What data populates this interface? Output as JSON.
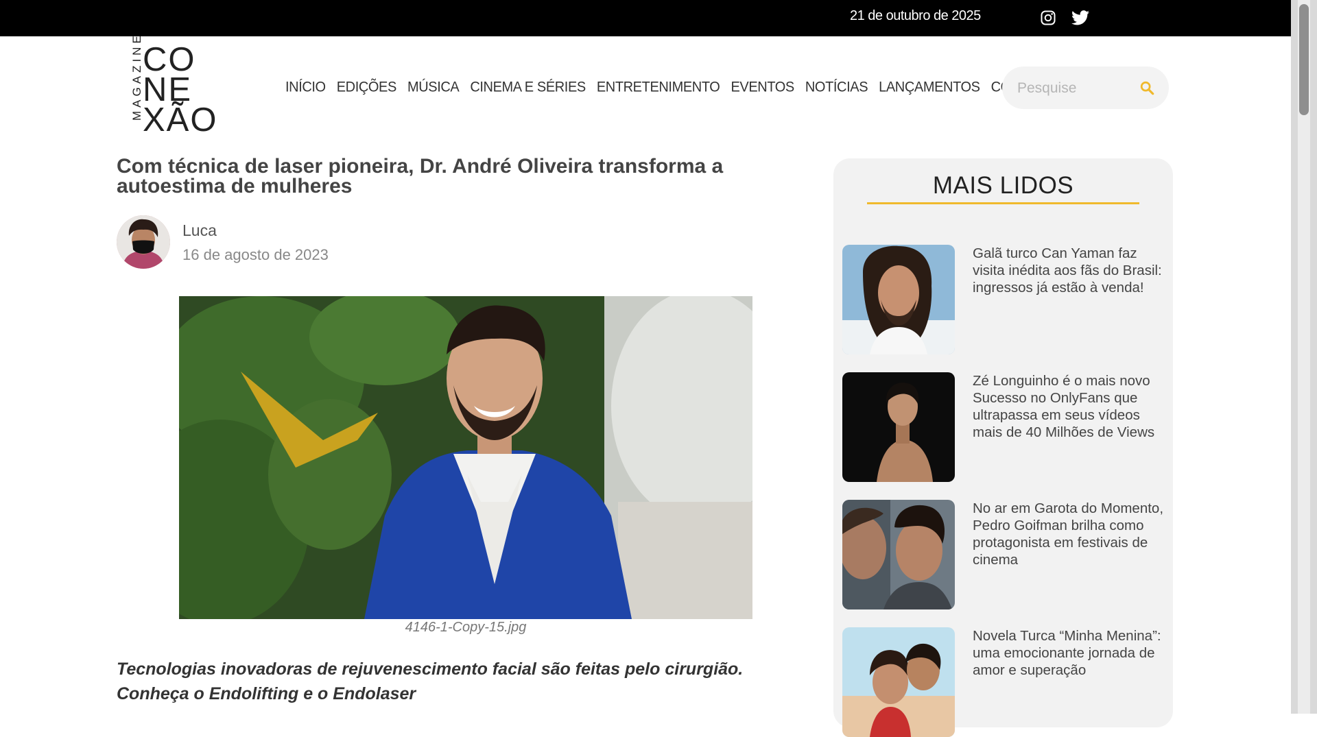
{
  "topbar": {
    "date": "21 de outubro de 2025"
  },
  "logo": {
    "magazine": "MAGAZINE",
    "line1": "CO",
    "line2": "NE",
    "line3": "XÃO"
  },
  "nav": [
    "INÍCIO",
    "EDIÇÕES",
    "MÚSICA",
    "CINEMA E SÉRIES",
    "ENTRETENIMENTO",
    "EVENTOS",
    "NOTÍCIAS",
    "LANÇAMENTOS",
    "CONTATO"
  ],
  "search": {
    "placeholder": "Pesquise"
  },
  "article": {
    "title": "Com técnica de laser pioneira, Dr. André Oliveira transforma a autoestima de mulheres",
    "author": "Luca",
    "date": "16 de agosto de 2023",
    "image_caption": "4146-1-Copy-15.jpg",
    "lead": "Tecnologias inovadoras de rejuvenescimento facial são feitas pelo cirurgião. Conheça o Endolifting e o Endolaser"
  },
  "sidebar": {
    "title": "MAIS LIDOS",
    "items": [
      {
        "text": "Galã turco Can Yaman faz visita inédita aos fãs do Brasil: ingressos já estão à venda!"
      },
      {
        "text": "Zé Longuinho é o mais novo Sucesso no OnlyFans que ultrapassa em seus vídeos mais de 40 Milhões de Views"
      },
      {
        "text": "No ar em Garota do Momento, Pedro Goifman brilha como protagonista em festivais de cinema"
      },
      {
        "text": "Novela Turca “Minha Menina”: uma emocionante jornada de amor e superação"
      }
    ]
  },
  "colors": {
    "accent": "#f0b92c",
    "topbar": "#000000",
    "sidebar_bg": "#f2f2f2"
  },
  "icons": [
    "instagram-icon",
    "twitter-icon",
    "search-icon"
  ]
}
